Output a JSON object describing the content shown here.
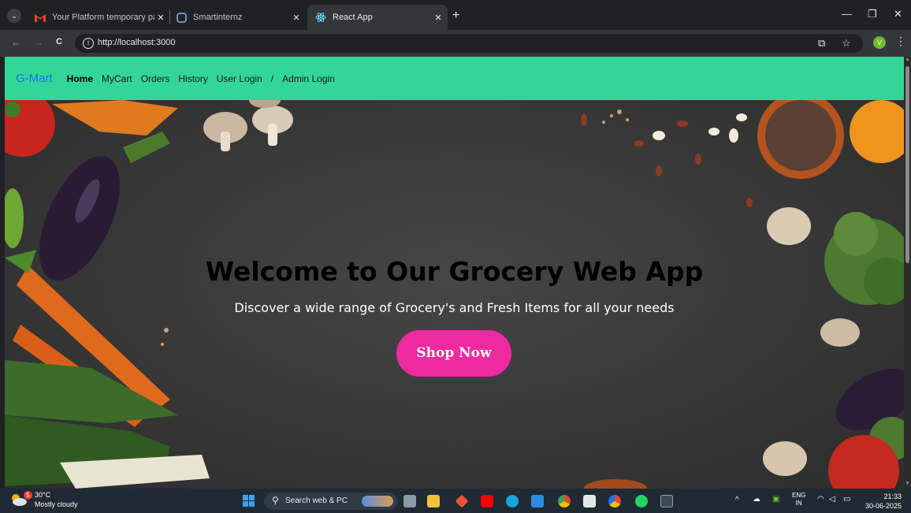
{
  "browser": {
    "tabs": [
      {
        "title": "Your Platform temporary passw",
        "favicon": "gmail-icon",
        "active": false
      },
      {
        "title": "Smartinternz",
        "favicon": "smartinternz-icon",
        "active": false
      },
      {
        "title": "React App",
        "favicon": "react-icon",
        "active": true
      }
    ],
    "close_glyph": "✕",
    "new_tab": "+",
    "window_controls": {
      "minimize": "—",
      "restore": "❐",
      "close": "✕"
    },
    "url": "http://localhost:3000",
    "nav": {
      "back": "←",
      "forward": "→",
      "reload": "C"
    },
    "profile_initial": "V"
  },
  "page": {
    "brand": "G-Mart",
    "nav_links": [
      "Home",
      "MyCart",
      "Orders",
      "History",
      "User Login"
    ],
    "nav_separator": "/",
    "admin_link": "Admin Login",
    "hero": {
      "title": "Welcome to Our Grocery Web App",
      "subtitle": "Discover a wide range of Grocery's and Fresh Items for all your needs",
      "cta": "Shop Now"
    },
    "colors": {
      "navbar": "#33d699",
      "brand": "#1a73e8",
      "cta": "#ee2aa0"
    }
  },
  "taskbar": {
    "weather_badge": "5",
    "temperature": "30°C",
    "condition": "Mostly cloudy",
    "search_placeholder": "Search web & PC",
    "lang_top": "ENG",
    "lang_bottom": "IN",
    "time": "21:33",
    "date": "30-06-2025"
  }
}
